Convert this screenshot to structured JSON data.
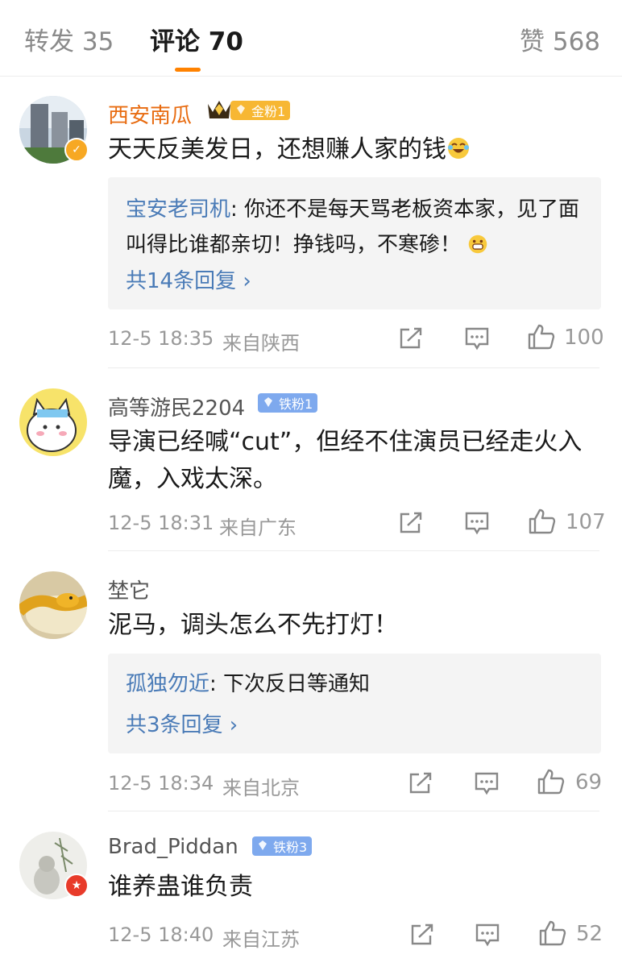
{
  "tabs": {
    "repost": "转发 35",
    "comments": "评论 70",
    "likes": "赞 568"
  },
  "comments": [
    {
      "username": "西安南瓜",
      "fan_badge": "金粉1",
      "text": "天天反美发日，还想赚人家的钱",
      "emoji": "laughing-crying-emoji",
      "reply": {
        "user": "宝安老司机",
        "text": ": 你还不是每天骂老板资本家，见了面叫得比谁都亲切！挣钱吗，不寒碜！",
        "emoji": "grin-emoji",
        "more": "共14条回复 ›"
      },
      "time": "12-5 18:35",
      "location": "来自陕西",
      "likes": "100"
    },
    {
      "username": "高等游民2204",
      "fan_badge": "铁粉1",
      "text": "导演已经喊“cut”，但经不住演员已经走火入魔，入戏太深。",
      "time": "12-5 18:31",
      "location": "来自广东",
      "likes": "107"
    },
    {
      "username": "埜它",
      "text": "泥马，调头怎么不先打灯！",
      "reply": {
        "user": "孤独勿近",
        "text": ": 下次反日等通知",
        "more": "共3条回复 ›"
      },
      "time": "12-5 18:34",
      "location": "来自北京",
      "likes": "69"
    },
    {
      "username": "Brad_Piddan",
      "fan_badge": "铁粉3",
      "text": "谁养蛊谁负责",
      "time": "12-5 18:40",
      "location": "来自江苏",
      "likes": "52"
    }
  ],
  "colors": {
    "accent": "#ff8200",
    "link": "#4a7bb7",
    "gold_badge": "#f7b733",
    "iron_badge": "#7ea9ee"
  }
}
